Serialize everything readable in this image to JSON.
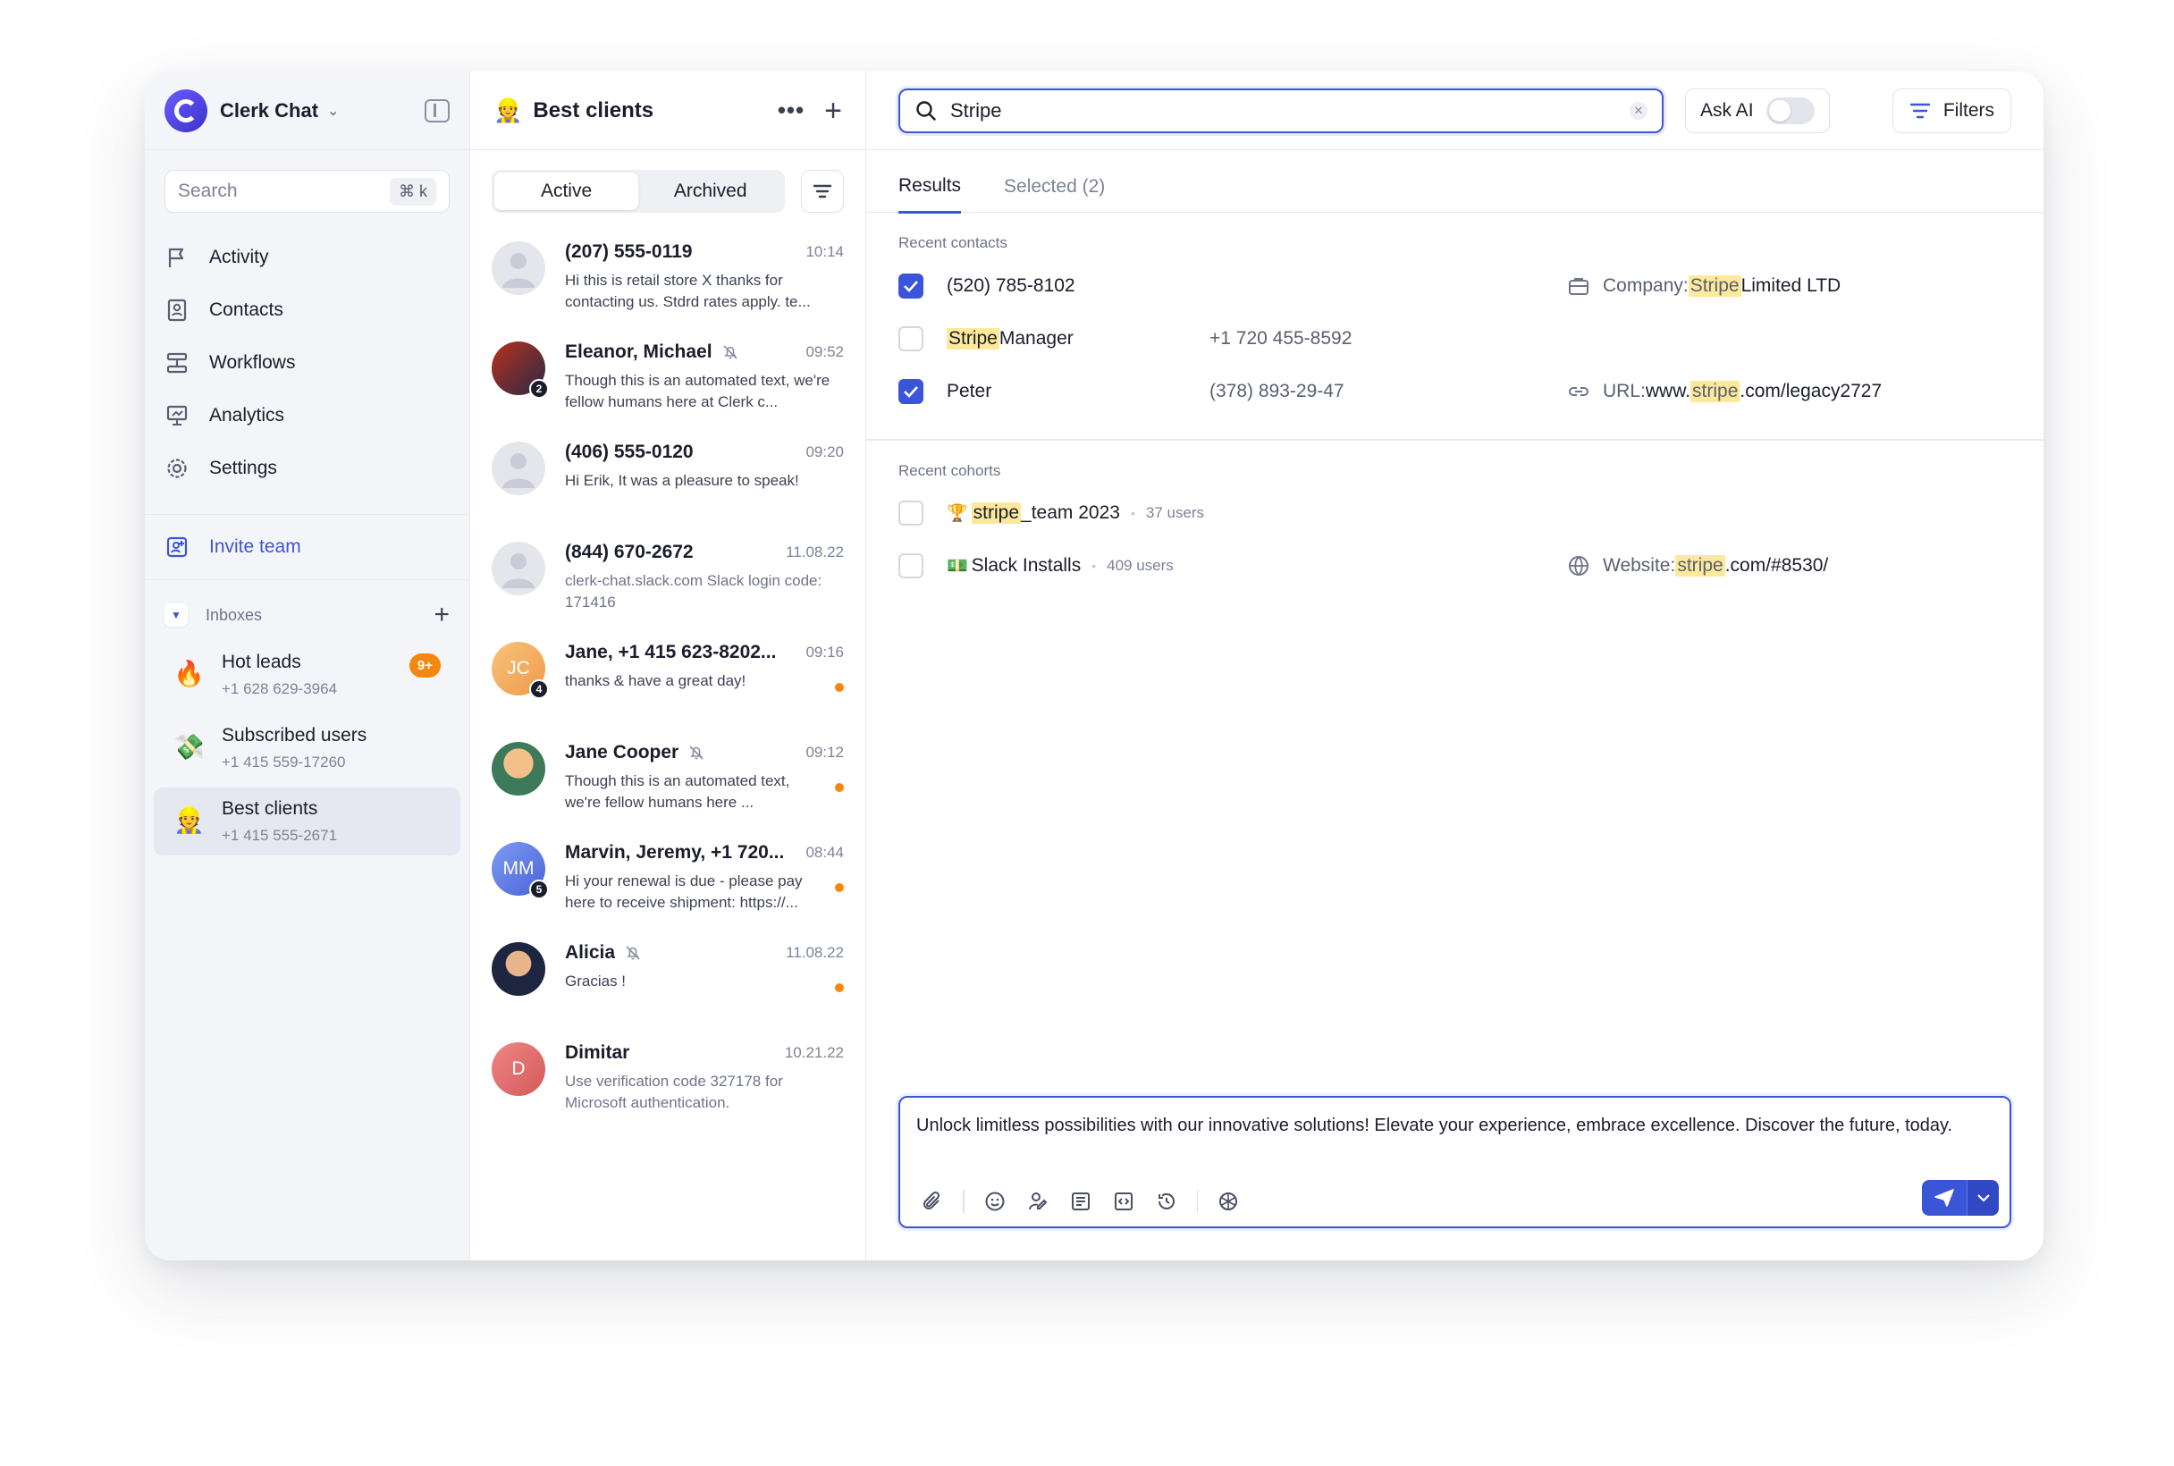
{
  "sidebar": {
    "brand": "Clerk Chat",
    "search_placeholder": "Search",
    "search_shortcut": "⌘ k",
    "nav": [
      {
        "label": "Activity"
      },
      {
        "label": "Contacts"
      },
      {
        "label": "Workflows"
      },
      {
        "label": "Analytics"
      },
      {
        "label": "Settings"
      }
    ],
    "invite": "Invite team",
    "inboxes_label": "Inboxes",
    "inboxes": [
      {
        "emoji": "🔥",
        "name": "Hot leads",
        "phone": "+1 628 629-3964",
        "badge": "9+"
      },
      {
        "emoji": "💸",
        "name": "Subscribed users",
        "phone": "+1 415 559-17260"
      },
      {
        "emoji": "👷",
        "name": "Best clients",
        "phone": "+1 415 555-2671"
      }
    ]
  },
  "conversations": {
    "emoji": "👷",
    "title": "Best clients",
    "segments": {
      "active": "Active",
      "archived": "Archived"
    },
    "items": [
      {
        "name": "(207) 555-0119",
        "time": "10:14",
        "msg": "Hi this is retail store X thanks for contacting us. Stdrd rates apply. te...",
        "initials": ""
      },
      {
        "name": "Eleanor, Michael",
        "time": "09:52",
        "msg": "Though this is an automated text, we're fellow humans here at Clerk c...",
        "badge": "2"
      },
      {
        "name": "(406) 555-0120",
        "time": "09:20",
        "msg": "Hi Erik, It was a pleasure to speak!"
      },
      {
        "name": "(844) 670-2672",
        "time": "11.08.22",
        "msg": "clerk-chat.slack.com Slack login code: 171416"
      },
      {
        "name": "Jane, +1 415 623-8202...",
        "time": "09:16",
        "msg": "thanks & have a great day!",
        "initials": "JC",
        "badge": "4"
      },
      {
        "name": "Jane Cooper",
        "time": "09:12",
        "msg": "Though this is an automated text, we're fellow humans here ..."
      },
      {
        "name": "Marvin, Jeremy, +1 720...",
        "time": "08:44",
        "msg": "Hi your renewal is due - please pay here to receive shipment: https://...",
        "initials": "MM",
        "badge": "5"
      },
      {
        "name": "Alicia",
        "time": "11.08.22",
        "msg": "Gracias !"
      },
      {
        "name": "Dimitar",
        "time": "10.21.22",
        "msg": "Use verification code 327178 for Microsoft authentication.",
        "initials": "D"
      }
    ]
  },
  "main": {
    "search_value": "Stripe",
    "ask_ai": "Ask AI",
    "filters": "Filters",
    "tabs": {
      "results": "Results",
      "selected": "Selected (2)"
    },
    "recent_contacts_label": "Recent contacts",
    "contacts": [
      {
        "a": "(520) 785-8102",
        "b": "",
        "c_pre": "Company: ",
        "c_hl": "Stripe",
        "c_post": " Limited LTD"
      },
      {
        "a_hl": "Stripe",
        "a": " Manager",
        "b": "+1 720 455-8592"
      },
      {
        "a": "Peter",
        "b": "(378) 893-29-47",
        "c_pre": "URL: ",
        "c_mid": "www.",
        "c_hl": "stripe",
        "c_post": ".com/legacy2727"
      }
    ],
    "recent_cohorts_label": "Recent cohorts",
    "cohorts": [
      {
        "emoji": "🏆",
        "hl": "stripe",
        "name": "_team 2023",
        "users": "37 users"
      },
      {
        "emoji": "💵",
        "name": "Slack Installs",
        "users": "409 users",
        "c_pre": "Website: ",
        "c_hl": "stripe",
        "c_post": ".com/#8530/"
      }
    ],
    "composer_text": "Unlock limitless possibilities with our innovative solutions! Elevate your experience, embrace excellence. Discover the future, today."
  }
}
